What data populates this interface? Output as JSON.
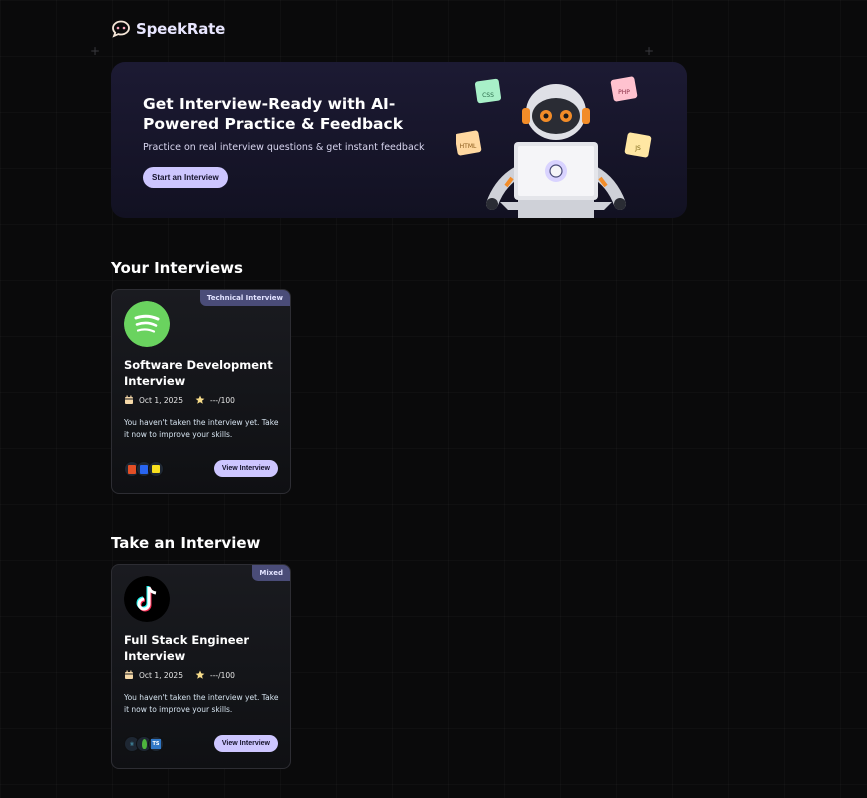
{
  "app": {
    "name": "SpeekRate"
  },
  "hero": {
    "title": "Get Interview-Ready with AI-Powered Practice & Feedback",
    "subtitle": "Practice on real interview questions & get instant feedback",
    "cta": "Start an Interview",
    "badges": [
      "CSS",
      "PHP",
      "HTML",
      "JS"
    ]
  },
  "sections": {
    "your_interviews": "Your Interviews",
    "take_interview": "Take an Interview"
  },
  "cards": [
    {
      "badge": "Technical Interview",
      "title": "Software Development Interview",
      "date": "Oct 1, 2025",
      "score": "---/100",
      "description": "You haven't taken the interview yet. Take it now to improve your skills.",
      "button": "View Interview",
      "logo": "spotify-logo",
      "tech": [
        "html5",
        "css3",
        "js"
      ]
    },
    {
      "badge": "Mixed",
      "title": "Full Stack Engineer Interview",
      "date": "Oct 1, 2025",
      "score": "---/100",
      "description": "You haven't taken the interview yet. Take it now to improve your skills.",
      "button": "View Interview",
      "logo": "tiktok-logo",
      "tech": [
        "react",
        "mongodb",
        "ts"
      ]
    }
  ],
  "colors": {
    "accent": "#cdc6ff",
    "badge": "#4a4c78",
    "background": "#0a0a0b"
  }
}
